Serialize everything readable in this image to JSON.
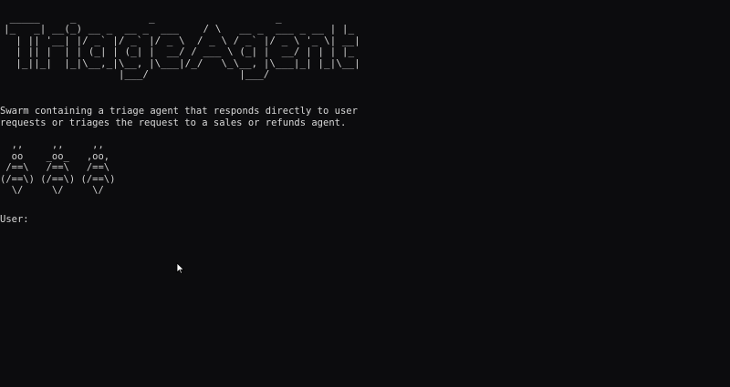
{
  "terminal": {
    "banner_ascii": " _____     _            _                    _   \n|_   _| __(_) __ _  __ _  ___    / \\   __ _  ___ _ __ | |_ \n  | || '__| |/ _` |/ _` |/ _ \\  / _ \\ / _` |/ _ \\ '_ \\| __|\n  | || |  | | (_| | (_| |  __/ / ___ \\ (_| |  __/ | | | |_ \n  |_||_|  |_|\\__,_|\\__, |\\___|/_/   \\_\\__, |\\___|_| |_|\\__|\n                   |___/               |___/               ",
    "description": "Swarm containing a triage agent that responds directly to user\nrequests or triages the request to a sales or refunds agent.",
    "agents_ascii": "  ,,     ,,     ,,\n  oo    _oo_   ,oo,\n /==\\   /==\\   /==\\\n(/==\\) (/==\\) (/==\\)\n  \\/     \\/     \\/",
    "prompt_label": "User:",
    "input_value": ""
  },
  "colors": {
    "background": "#0c0c0e",
    "foreground": "#d6d6d6"
  },
  "icons": {
    "pointer": "mouse-pointer-icon"
  }
}
